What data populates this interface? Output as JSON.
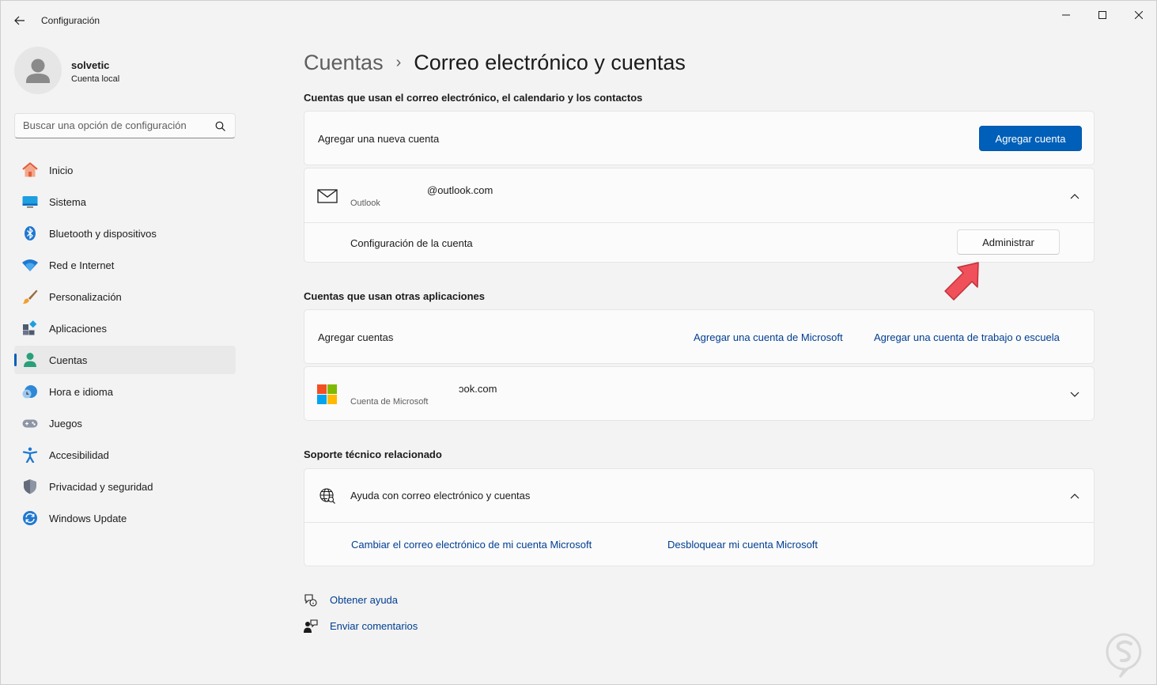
{
  "window": {
    "title": "Configuración",
    "minimize_glyph": "—",
    "maximize_glyph": "☐",
    "close_glyph": "✕"
  },
  "profile": {
    "name": "solvetic",
    "account_type": "Cuenta local"
  },
  "search": {
    "placeholder": "Buscar una opción de configuración"
  },
  "sidebar": {
    "items": [
      {
        "label": "Inicio",
        "icon": "home-icon"
      },
      {
        "label": "Sistema",
        "icon": "system-icon"
      },
      {
        "label": "Bluetooth y dispositivos",
        "icon": "bluetooth-icon"
      },
      {
        "label": "Red e Internet",
        "icon": "wifi-icon"
      },
      {
        "label": "Personalización",
        "icon": "brush-icon"
      },
      {
        "label": "Aplicaciones",
        "icon": "apps-icon"
      },
      {
        "label": "Cuentas",
        "icon": "accounts-icon",
        "active": true
      },
      {
        "label": "Hora e idioma",
        "icon": "time-language-icon"
      },
      {
        "label": "Juegos",
        "icon": "gamepad-icon"
      },
      {
        "label": "Accesibilidad",
        "icon": "accessibility-icon"
      },
      {
        "label": "Privacidad y seguridad",
        "icon": "shield-icon"
      },
      {
        "label": "Windows Update",
        "icon": "update-icon"
      }
    ]
  },
  "breadcrumb": {
    "parent": "Cuentas",
    "separator": "›",
    "current": "Correo electrónico y cuentas"
  },
  "email_section": {
    "title": "Cuentas que usan el correo electrónico, el calendario y los contactos",
    "add_row_label": "Agregar una nueva cuenta",
    "add_button": "Agregar cuenta",
    "account": {
      "email": "@outlook.com",
      "provider": "Outlook",
      "settings_label": "Configuración de la cuenta",
      "manage_button": "Administrar"
    }
  },
  "other_apps_section": {
    "title": "Cuentas que usan otras aplicaciones",
    "add_row_label": "Agregar cuentas",
    "link_microsoft": "Agregar una cuenta de Microsoft",
    "link_work": "Agregar una cuenta de trabajo o escuela",
    "account": {
      "email": "ɔok.com",
      "type": "Cuenta de Microsoft"
    }
  },
  "support_section": {
    "title": "Soporte técnico relacionado",
    "help_label": "Ayuda con correo electrónico y cuentas",
    "link_change_email": "Cambiar el correo electrónico de mi cuenta Microsoft",
    "link_unlock": "Desbloquear mi cuenta Microsoft"
  },
  "footer": {
    "get_help": "Obtener ayuda",
    "send_feedback": "Enviar comentarios"
  },
  "colors": {
    "accent": "#005fb8",
    "link": "#003e92",
    "annotation_arrow": "#f0505a"
  }
}
